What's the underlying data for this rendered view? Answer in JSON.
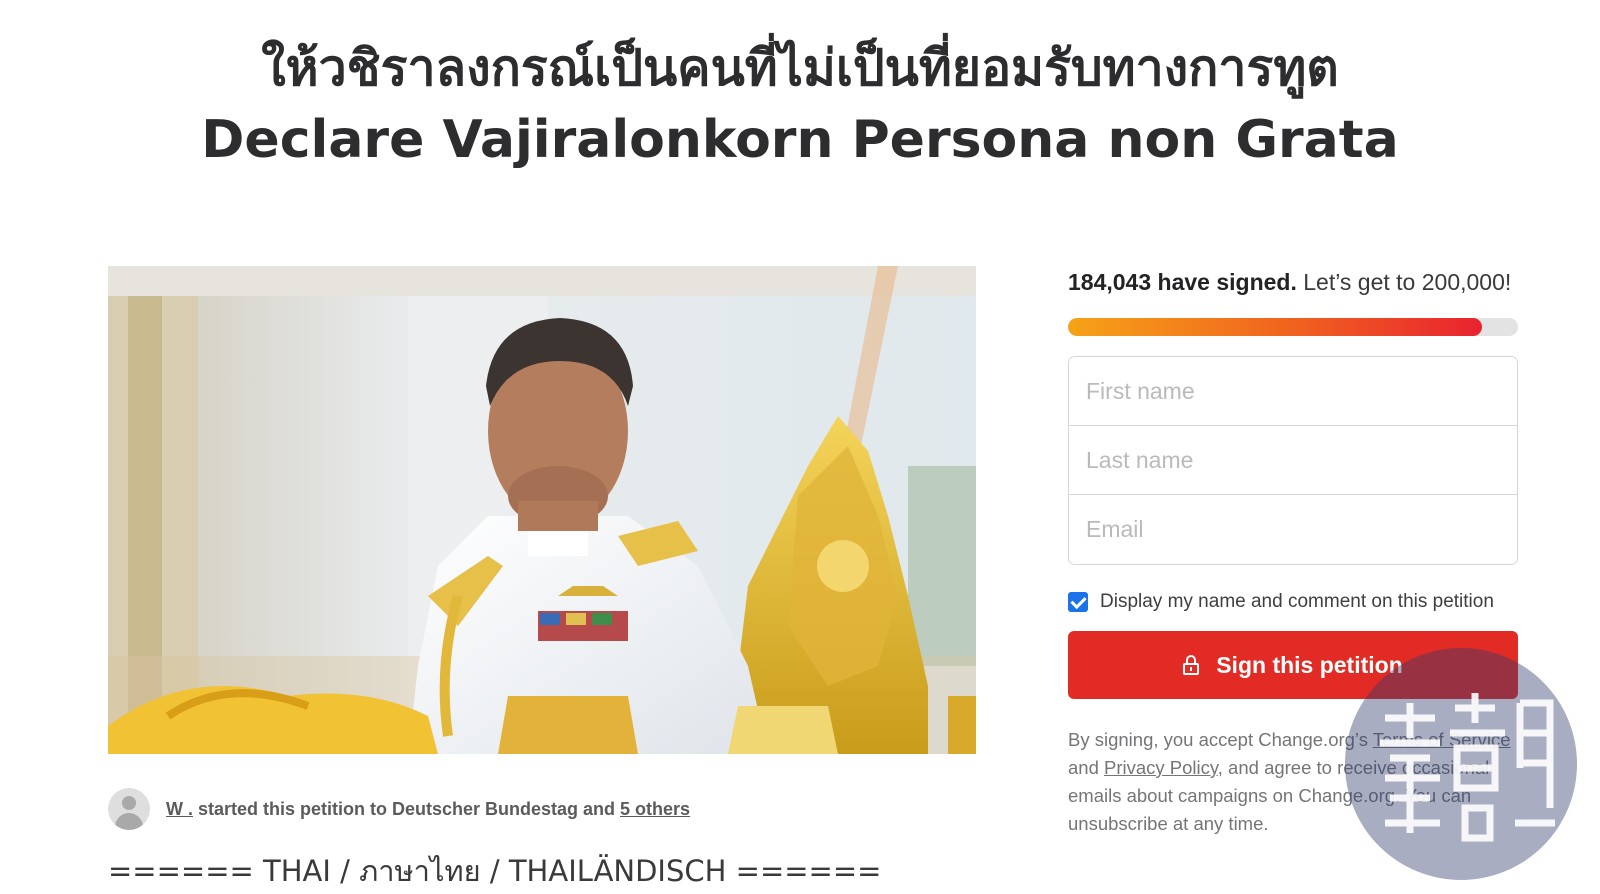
{
  "petition": {
    "title_thai": "ให้วชิราลงกรณ์เป็นคนที่ไม่เป็นที่ยอมรับทางการทูต",
    "title_en": "Declare Vajiralonkorn Persona non Grata",
    "starter_name": "W .",
    "starter_text": " started this petition to Deutscher Bundestag and ",
    "starter_others": "5 others",
    "description_first_line": "====== THAI / ภาษาไทย / THAILÄNDISCH ======"
  },
  "signature": {
    "signed_count": "184,043 have signed.",
    "goal_text": " Let’s get to 200,000!",
    "progress_fraction": 0.92
  },
  "form": {
    "first_name_placeholder": "First name",
    "last_name_placeholder": "Last name",
    "email_placeholder": "Email",
    "display_checkbox_label": "Display my name and comment on this petition",
    "display_checked": true,
    "sign_button_label": "Sign this petition"
  },
  "legal": {
    "prefix": "By signing, you accept Change.org’s ",
    "terms_link": "Terms of Service",
    "and": " and ",
    "privacy_link": "Privacy Policy",
    "suffix": ", and agree to receive occasional emails about campaigns on Change.org. You can unsubscribe at any time."
  },
  "colors": {
    "sign_button": "#e22b25",
    "progress_start": "#f6a317",
    "progress_end": "#e8232f",
    "checkbox": "#1a73e8"
  }
}
